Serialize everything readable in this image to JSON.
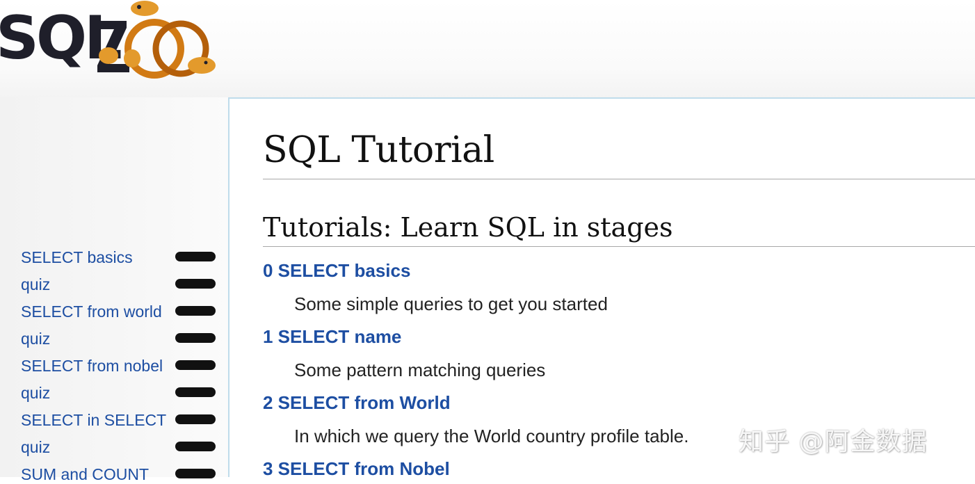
{
  "logo": {
    "text": "SQLZOO"
  },
  "page_title": "SQL Tutorial",
  "section_title": "Tutorials: Learn SQL in stages",
  "tutorials": [
    {
      "title": "0 SELECT basics",
      "desc": "Some simple queries to get you started"
    },
    {
      "title": "1 SELECT name",
      "desc": "Some pattern matching queries"
    },
    {
      "title": "2 SELECT from World",
      "desc": "In which we query the World country profile table."
    },
    {
      "title": "3 SELECT from Nobel"
    }
  ],
  "sidebar": {
    "items": [
      {
        "label": "SELECT basics"
      },
      {
        "label": "quiz"
      },
      {
        "label": "SELECT from world"
      },
      {
        "label": "quiz"
      },
      {
        "label": "SELECT from nobel"
      },
      {
        "label": "quiz"
      },
      {
        "label": "SELECT in SELECT"
      },
      {
        "label": "quiz"
      },
      {
        "label": "SUM and COUNT"
      }
    ]
  },
  "watermark": "知乎 @阿金数据",
  "colors": {
    "link": "#1d4ea2",
    "border": "#bfdceb",
    "logo_orange": "#e08a1e",
    "logo_dark": "#1f1f2a"
  }
}
